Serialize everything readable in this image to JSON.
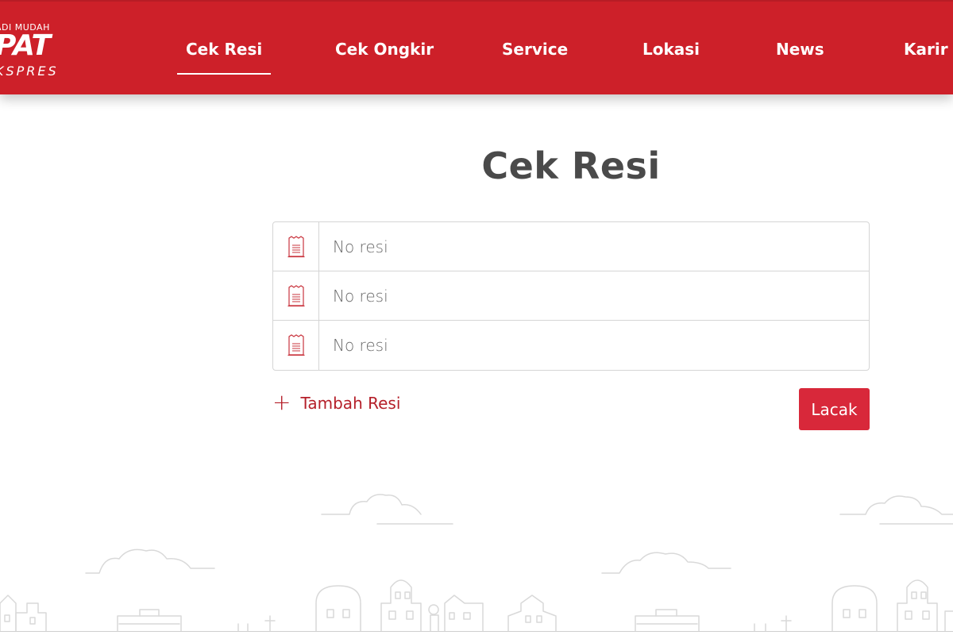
{
  "brand": {
    "tagline": "ADI MUDAH",
    "mark": "PAT",
    "sub": "KSPRES",
    "color": "#cd2029"
  },
  "nav": {
    "items": [
      {
        "label": "Cek Resi",
        "active": true
      },
      {
        "label": "Cek Ongkir",
        "active": false
      },
      {
        "label": "Service",
        "active": false
      },
      {
        "label": "Lokasi",
        "active": false
      },
      {
        "label": "News",
        "active": false
      },
      {
        "label": "Karir",
        "active": false
      }
    ]
  },
  "main": {
    "title": "Cek Resi",
    "inputs": [
      {
        "placeholder": "No resi",
        "value": "",
        "icon": "receipt-icon"
      },
      {
        "placeholder": "No resi",
        "value": "",
        "icon": "receipt-icon"
      },
      {
        "placeholder": "No resi",
        "value": "",
        "icon": "receipt-icon"
      }
    ],
    "add_label": "Tambah Resi",
    "add_icon": "plus-icon",
    "submit_label": "Lacak",
    "accent": "#d8283a"
  }
}
